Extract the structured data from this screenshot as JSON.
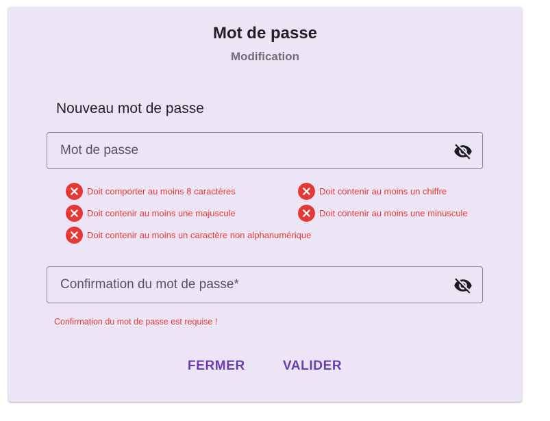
{
  "dialog": {
    "title": "Mot de passe",
    "subtitle": "Modification",
    "section_label": "Nouveau mot de passe"
  },
  "password_field": {
    "placeholder": "Mot de passe",
    "value": "",
    "toggle_icon": "eye-off-icon"
  },
  "rules": [
    {
      "text": "Doit comporter au moins 8 caractères",
      "status": "failed",
      "icon": "error-circle-icon"
    },
    {
      "text": "Doit contenir au moins un chiffre",
      "status": "failed",
      "icon": "error-circle-icon"
    },
    {
      "text": "Doit contenir au moins une majuscule",
      "status": "failed",
      "icon": "error-circle-icon"
    },
    {
      "text": "Doit contenir au moins une minuscule",
      "status": "failed",
      "icon": "error-circle-icon"
    },
    {
      "text": "Doit contenir au moins un caractère non alphanumérique",
      "status": "failed",
      "icon": "error-circle-icon"
    }
  ],
  "confirm_field": {
    "placeholder": "Confirmation du mot de passe*",
    "value": "",
    "toggle_icon": "eye-off-icon",
    "error": "Confirmation du mot de passe est requise !"
  },
  "actions": {
    "close_label": "FERMER",
    "submit_label": "VALIDER"
  },
  "colors": {
    "dialog_background": "#ece5f6",
    "error": "#e53935",
    "primary": "#6a3cb0"
  }
}
